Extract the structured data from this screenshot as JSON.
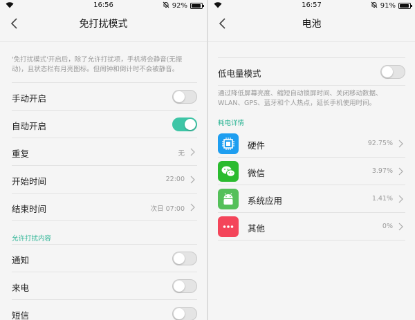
{
  "left": {
    "status": {
      "time": "16:56",
      "battery": "92%",
      "battery_level": 0.92
    },
    "title": "免打扰模式",
    "description": "'免打扰模式'开启后，除了允许打扰项，手机将会静音(无振动)，且状态栏有月亮图标。但闹钟和倒计时不会被静音。",
    "rows": [
      {
        "label": "手动开启",
        "toggle": false
      },
      {
        "label": "自动开启",
        "toggle": true
      },
      {
        "label": "重复",
        "value": "无"
      },
      {
        "label": "开始时间",
        "value": "22:00"
      },
      {
        "label": "结束时间",
        "value": "次日 07:00"
      }
    ],
    "section_title": "允许打扰内容",
    "allow_rows": [
      {
        "label": "通知",
        "toggle": false
      },
      {
        "label": "来电",
        "toggle": false
      },
      {
        "label": "短信",
        "toggle": false
      }
    ]
  },
  "right": {
    "status": {
      "time": "16:57",
      "battery": "91%",
      "battery_level": 0.91
    },
    "title": "电池",
    "low_power": {
      "label": "低电量模式",
      "toggle": false
    },
    "description": "通过降低屏幕亮度、缩短自动锁屏时间、关闭移动数据、WLAN、GPS、蓝牙和个人热点，延长手机使用时间。",
    "section_title": "耗电详情",
    "apps": [
      {
        "name": "硬件",
        "percent": "92.75%",
        "icon": "hardware-chip-icon",
        "color": "#1e9ef0"
      },
      {
        "name": "微信",
        "percent": "3.97%",
        "icon": "wechat-icon",
        "color": "#2bbb2f"
      },
      {
        "name": "系统应用",
        "percent": "1.41%",
        "icon": "android-icon",
        "color": "#55c05a"
      },
      {
        "name": "其他",
        "percent": "0%",
        "icon": "more-dots-icon",
        "color": "#f4455a"
      }
    ]
  },
  "colors": {
    "accent": "#3ec5a6",
    "section_text": "#2bb494",
    "background": "#f5f5f5"
  }
}
